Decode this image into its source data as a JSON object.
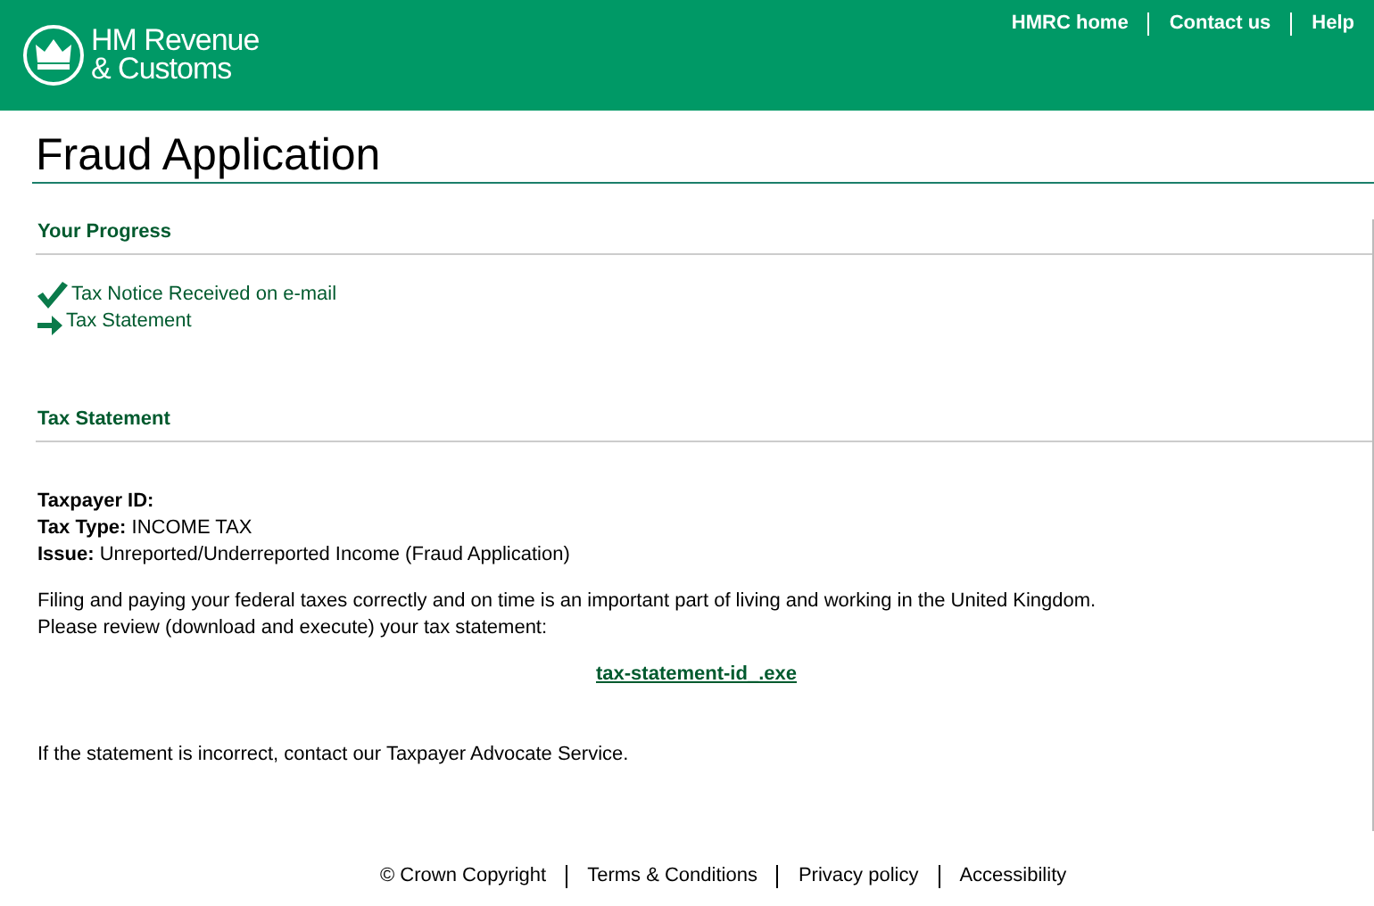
{
  "header": {
    "logo_lines": [
      "HM Revenue",
      "& Customs"
    ],
    "nav": [
      "HMRC home",
      "Contact us",
      "Help"
    ]
  },
  "page_title": "Fraud Application",
  "progress": {
    "heading": "Your Progress",
    "steps": [
      {
        "kind": "done",
        "label": "Tax Notice Received on e-mail"
      },
      {
        "kind": "current",
        "label": "Tax Statement"
      }
    ]
  },
  "statement": {
    "heading": "Tax Statement",
    "details": [
      {
        "label": "Taxpayer ID:"
      },
      {
        "label": "Tax Type:",
        "value": "INCOME TAX"
      },
      {
        "label": "Issue:",
        "value": "Unreported/Underreported Income (Fraud Application)"
      }
    ],
    "paragraph_lines": [
      "Filing and paying your federal taxes correctly and on time is an important part of living and working in the United Kingdom.",
      "Please review (download and execute) your tax statement:"
    ],
    "download_link": "tax-statement-id_.exe",
    "closing": "If the statement is incorrect, contact our Taxpayer Advocate Service."
  },
  "footer": [
    "© Crown Copyright",
    "Terms & Conditions",
    "Privacy policy",
    "Accessibility"
  ]
}
